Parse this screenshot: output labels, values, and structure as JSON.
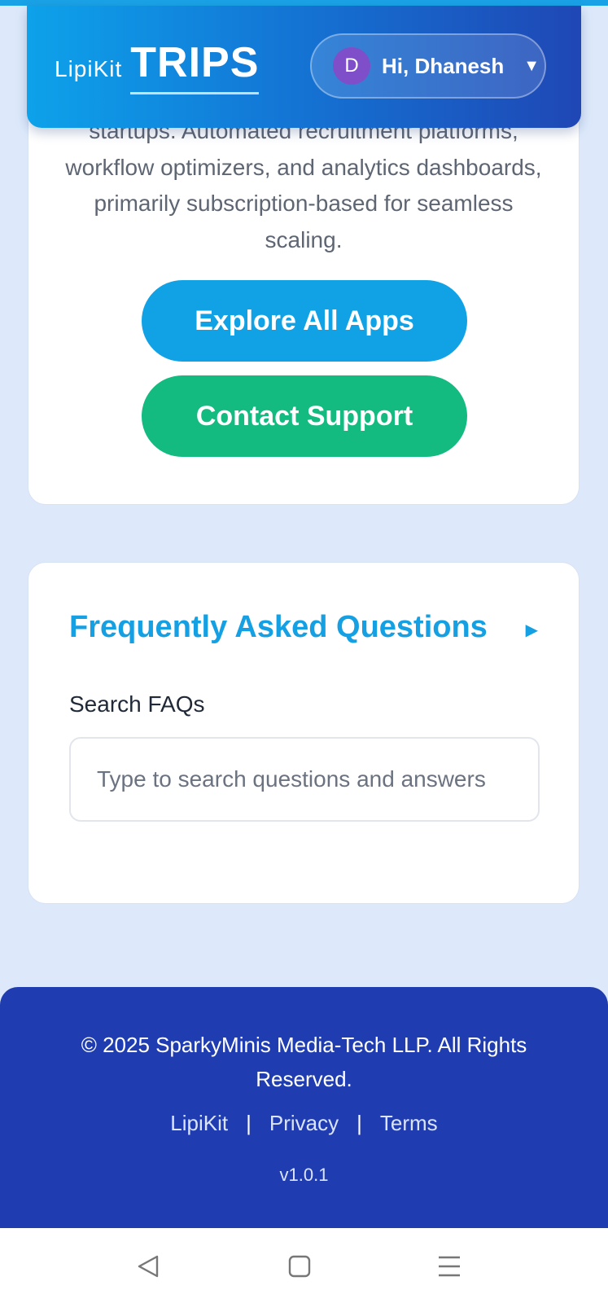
{
  "header": {
    "brand_small": "LipiKit",
    "brand_big": "TRIPS",
    "user_initial": "D",
    "user_greeting": "Hi, Dhanesh",
    "dropdown_icon": "caret-down-icon"
  },
  "intro": {
    "description": "startups. Automated recruitment platforms, workflow optimizers, and analytics dashboards, primarily subscription-based for seamless scaling.",
    "explore_label": "Explore All Apps",
    "support_label": "Contact Support"
  },
  "faq": {
    "title": "Frequently Asked Questions",
    "toggle_icon": "triangle-right-icon",
    "search_label": "Search FAQs",
    "search_placeholder": "Type to search questions and answers",
    "search_value": ""
  },
  "footer": {
    "copyright": "© 2025 SparkyMinis Media-Tech LLP. All Rights Reserved.",
    "links": [
      "LipiKit",
      "Privacy",
      "Terms"
    ],
    "separator": "|",
    "version": "v1.0.1"
  },
  "navbar": {
    "back_icon": "back-icon",
    "home_icon": "home-icon",
    "menu_icon": "menu-icon"
  },
  "colors": {
    "page_bg": "#dde9fb",
    "primary": "#11a2e6",
    "success": "#14bb80",
    "footer_bg": "#1f3db0",
    "avatar_bg": "#7f4fc9"
  }
}
